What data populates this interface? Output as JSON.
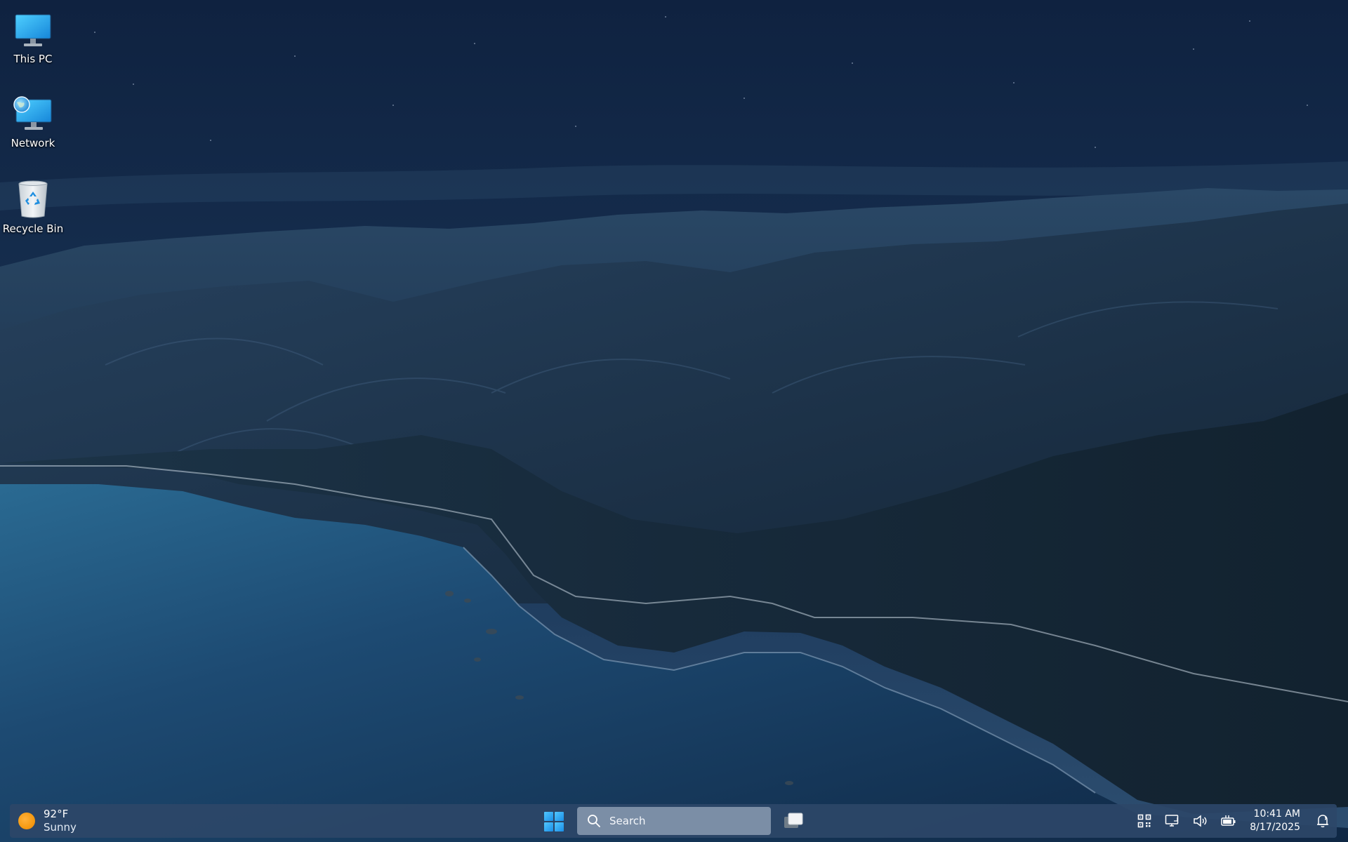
{
  "desktop": {
    "icons": [
      {
        "label": "This PC",
        "icon": "monitor-icon"
      },
      {
        "label": "Network",
        "icon": "network-icon"
      },
      {
        "label": "Recycle Bin",
        "icon": "recycle-bin-icon"
      }
    ]
  },
  "taskbar": {
    "weather": {
      "temperature": "92°F",
      "condition": "Sunny",
      "icon": "sun-icon"
    },
    "search": {
      "label": "Search",
      "icon": "search-icon"
    },
    "start_icon": "windows-logo-icon",
    "task_view_icon": "task-view-icon",
    "tray": {
      "icons": [
        "qr-code-icon",
        "display-network-icon",
        "volume-icon",
        "battery-plug-icon",
        "notification-icon"
      ],
      "time": "10:41 AM",
      "date": "8/17/2025"
    }
  },
  "colors": {
    "taskbar": "#2c4668",
    "search_box": "#7b8ea6",
    "start_blue": "#2ea7ef",
    "sun": "#f59a12"
  }
}
